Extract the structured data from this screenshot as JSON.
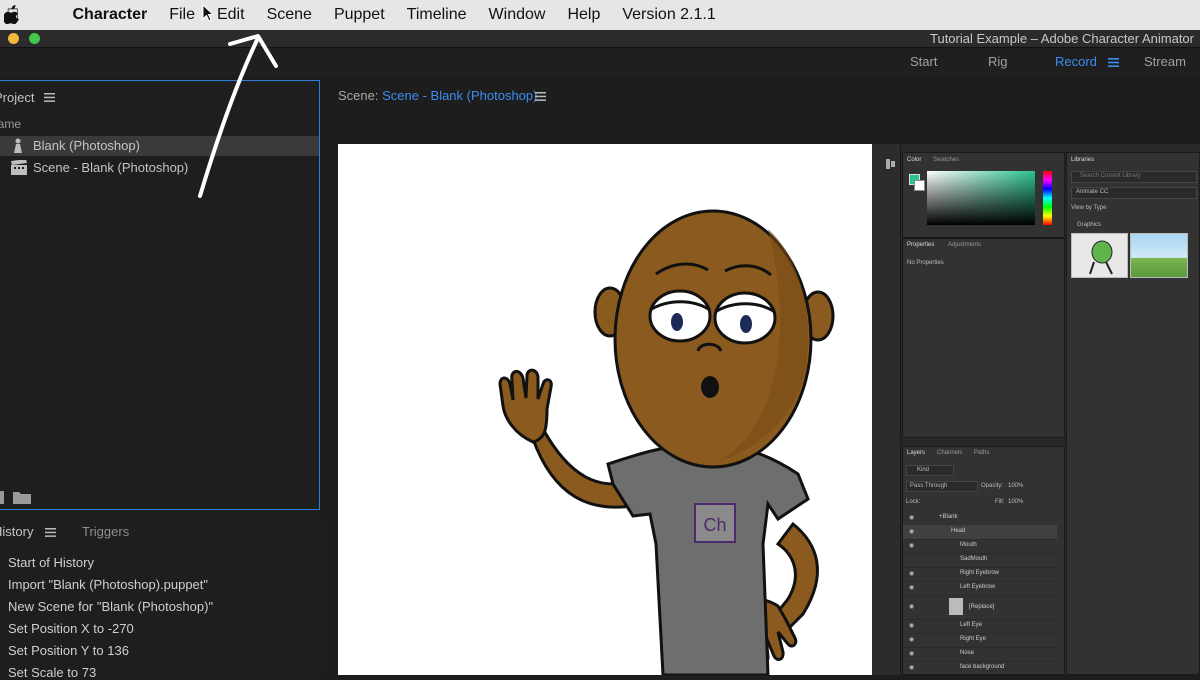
{
  "menubar": {
    "app_name": "Character",
    "items": [
      "File",
      "Edit",
      "Scene",
      "Puppet",
      "Timeline",
      "Window",
      "Help",
      "Version 2.1.1"
    ]
  },
  "window": {
    "title": "Tutorial Example – Adobe Character Animator"
  },
  "workspaces": {
    "items": [
      "Start",
      "Rig",
      "Record",
      "Stream"
    ],
    "active": "Record"
  },
  "project": {
    "title": "Project",
    "column_header": "Name",
    "items": [
      "Blank (Photoshop)",
      "Scene - Blank (Photoshop)"
    ]
  },
  "history": {
    "tabs": [
      "History",
      "Triggers"
    ],
    "entries": [
      "Start of History",
      "Import \"Blank (Photoshop).puppet\"",
      "New Scene for \"Blank (Photoshop)\"",
      "Set Position X to -270",
      "Set Position Y to 136",
      "Set Scale to 73"
    ]
  },
  "scene": {
    "label": "Scene:",
    "name": "Scene - Blank (Photoshop)"
  },
  "character": {
    "shirt_logo": "Ch"
  },
  "photoshop": {
    "color_tabs": [
      "Color",
      "Swatches"
    ],
    "properties_tabs": [
      "Properties",
      "Adjustments"
    ],
    "properties_empty": "No Properties",
    "libraries": {
      "title": "Libraries",
      "search_placeholder": "Search Current Library",
      "library_name": "Animate CC",
      "view_by": "View by Type",
      "section": "Graphics"
    },
    "layers_tabs": [
      "Layers",
      "Channels",
      "Paths"
    ],
    "kind_filter": "Kind",
    "blend_mode": "Pass Through",
    "opacity_label": "Opacity:",
    "opacity_value": "100%",
    "lock_label": "Lock:",
    "fill_label": "Fill:",
    "fill_value": "100%",
    "layers": [
      "+Blank",
      "Head",
      "Mouth",
      "SadMouth",
      "Right Eyebrow",
      "Left Eyebrow",
      "[Replace]",
      "Left Eye",
      "Right Eye",
      "Nose",
      "face background"
    ]
  },
  "colors": {
    "accent_blue": "#3b8df0",
    "skin": "#8a5a1e",
    "shirt": "#6e6e6e",
    "logo_purple": "#4b2a6e"
  }
}
